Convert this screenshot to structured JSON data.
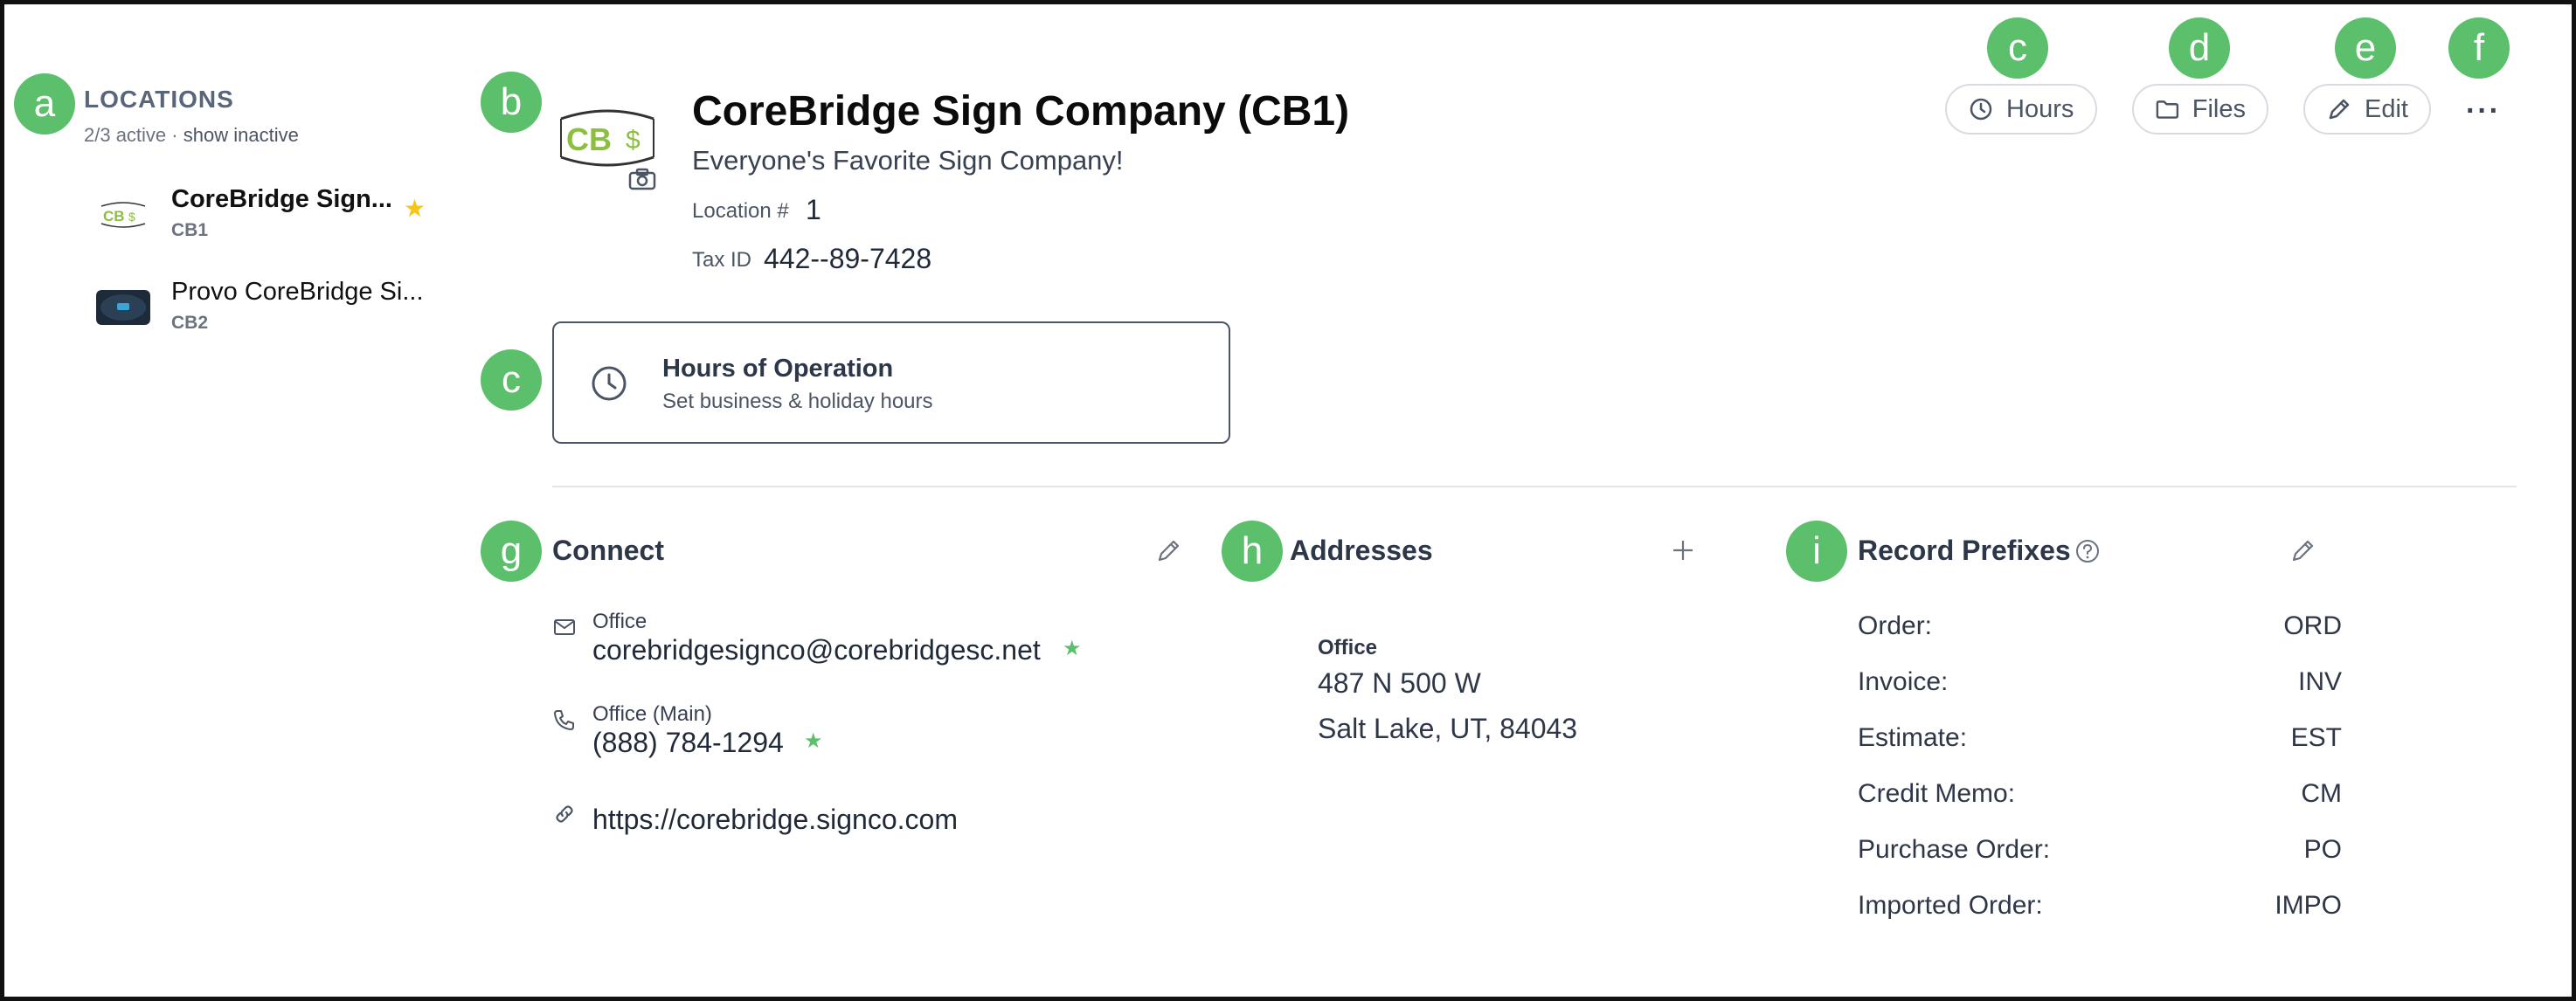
{
  "markers": {
    "a": "a",
    "b": "b",
    "c_top": "c",
    "d": "d",
    "e": "e",
    "f": "f",
    "c_card": "c",
    "g": "g",
    "h": "h",
    "i": "i"
  },
  "sidebar": {
    "title": "LOCATIONS",
    "active_count": "2/3 active",
    "separator": "·",
    "show_inactive": "show inactive",
    "items": [
      {
        "name": "CoreBridge Sign...",
        "code": "CB1",
        "default": true,
        "logo": "cb-logo"
      },
      {
        "name": "Provo CoreBridge Si...",
        "code": "CB2",
        "default": false,
        "logo": "dark-sign-logo"
      }
    ]
  },
  "header": {
    "logo_text": "CB",
    "title": "CoreBridge Sign Company (CB1)",
    "tagline": "Everyone's Favorite Sign Company!",
    "location_label": "Location #",
    "location_value": "1",
    "taxid_label": "Tax ID",
    "taxid_value": "442--89-7428"
  },
  "actions": {
    "hours": "Hours",
    "files": "Files",
    "edit": "Edit",
    "more": "···"
  },
  "hours_card": {
    "title": "Hours of Operation",
    "subtitle": "Set business & holiday hours"
  },
  "connect": {
    "title": "Connect",
    "email_label": "Office",
    "email_value": "corebridgesignco@corebridgesc.net",
    "phone_label": "Office (Main)",
    "phone_value": "(888) 784-1294",
    "website": "https://corebridge.signco.com"
  },
  "addresses": {
    "title": "Addresses",
    "label": "Office",
    "line1": "487 N 500 W",
    "line2": "Salt Lake, UT, 84043"
  },
  "prefixes": {
    "title": "Record Prefixes",
    "rows": [
      {
        "label": "Order:",
        "value": "ORD"
      },
      {
        "label": "Invoice:",
        "value": "INV"
      },
      {
        "label": "Estimate:",
        "value": "EST"
      },
      {
        "label": "Credit Memo:",
        "value": "CM"
      },
      {
        "label": "Purchase Order:",
        "value": "PO"
      },
      {
        "label": "Imported Order:",
        "value": "IMPO"
      }
    ]
  },
  "colors": {
    "marker": "#5cbf6b",
    "star_default": "#f5c518",
    "star_primary": "#5cbf6b",
    "logo_green": "#8cbf3f"
  }
}
